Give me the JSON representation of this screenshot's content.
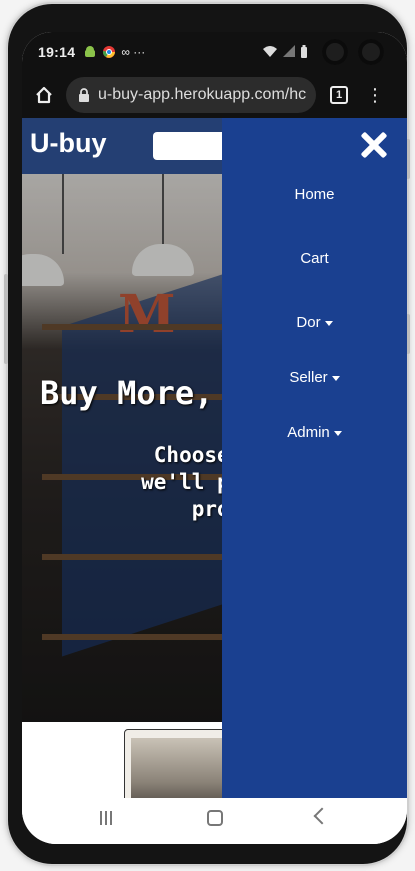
{
  "status": {
    "time": "19:14",
    "misc_icons": "∞  ···"
  },
  "browser": {
    "url": "u-buy-app.herokuapp.com/hc",
    "tab_count": "1"
  },
  "site": {
    "brand": "U-buy",
    "search_placeholder": ""
  },
  "hero": {
    "title": "Buy More,",
    "subtitle": "Choose you\nwe'll provic\nprod"
  },
  "sidenav": {
    "items": [
      {
        "label": "Home",
        "dropdown": false
      },
      {
        "label": "Cart",
        "dropdown": false
      },
      {
        "label": "Dor",
        "dropdown": true
      },
      {
        "label": "Seller",
        "dropdown": true
      },
      {
        "label": "Admin",
        "dropdown": true
      }
    ]
  },
  "colors": {
    "navbar": "#243f73",
    "sidenav": "#1a4090"
  }
}
